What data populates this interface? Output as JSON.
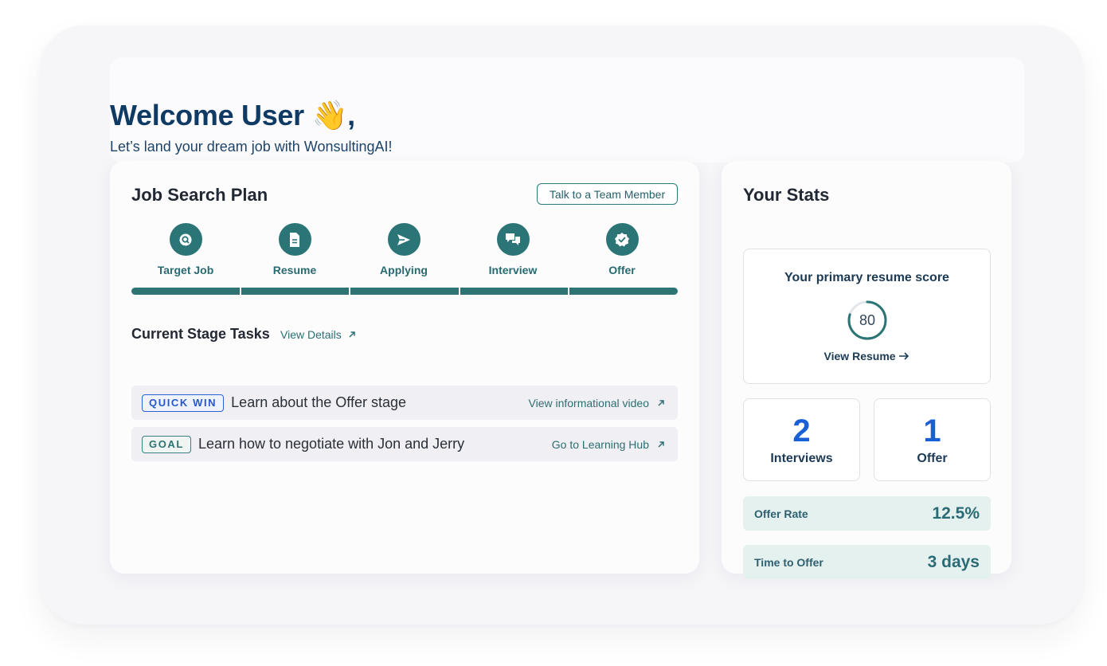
{
  "welcome": {
    "title": "Welcome User 👋,",
    "subtitle": "Let’s land your dream job with WonsultingAI!"
  },
  "plan": {
    "title": "Job Search Plan",
    "talk_button": "Talk to a Team Member",
    "steps": [
      {
        "label": "Target Job",
        "icon": "target-search-icon"
      },
      {
        "label": "Resume",
        "icon": "document-icon"
      },
      {
        "label": "Applying",
        "icon": "send-icon"
      },
      {
        "label": "Interview",
        "icon": "chat-bubbles-icon"
      },
      {
        "label": "Offer",
        "icon": "verified-badge-icon"
      }
    ],
    "progress_completed_segments": 5,
    "progress_total_segments": 5,
    "tasks_title": "Current Stage Tasks",
    "view_details": "View Details",
    "tasks": [
      {
        "badge": "QUICK WIN",
        "text": "Learn about the Offer stage",
        "link": "View informational video"
      },
      {
        "badge": "GOAL",
        "text": "Learn how to negotiate with Jon and Jerry",
        "link": "Go to Learning Hub"
      }
    ]
  },
  "stats": {
    "title": "Your Stats",
    "score_title": "Your primary resume score",
    "score_value": "80",
    "score_fraction": 0.8,
    "view_resume": "View Resume",
    "interviews_count": "2",
    "interviews_label": "Interviews",
    "offers_count": "1",
    "offers_label": "Offer",
    "offer_rate_label": "Offer Rate",
    "offer_rate_value": "12.5%",
    "time_to_offer_label": "Time to Offer",
    "time_to_offer_value": "3 days"
  },
  "colors": {
    "primary_teal": "#2b7576",
    "heading_navy": "#0f3a63",
    "accent_blue": "#1a5fd6",
    "metric_bg": "#e5f1ee"
  }
}
